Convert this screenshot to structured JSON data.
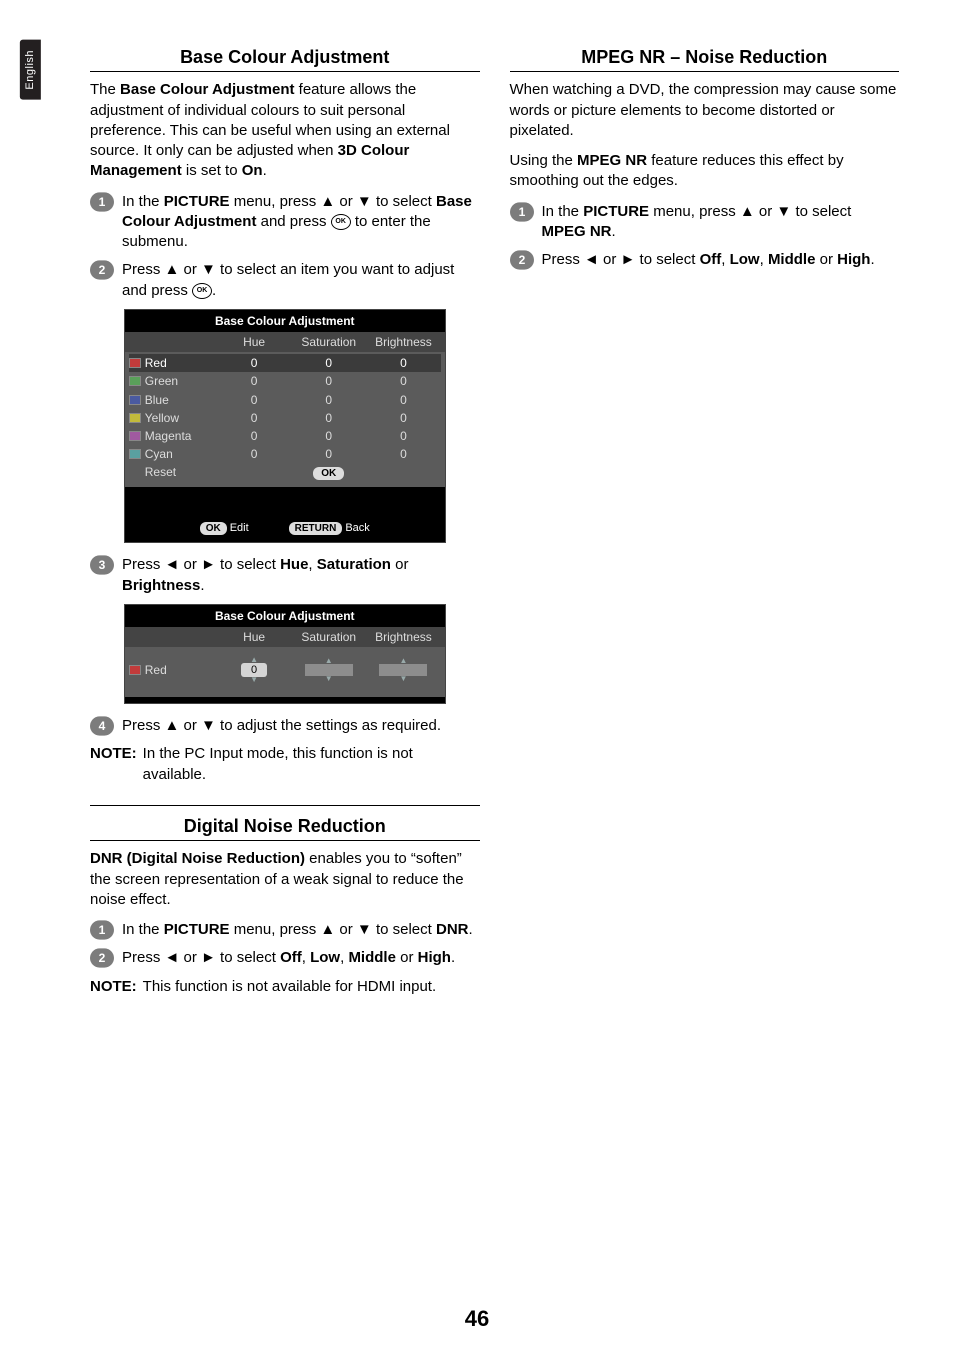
{
  "language_tab": "English",
  "page_number": "46",
  "icons": {
    "ok_small": "OK"
  },
  "left": {
    "sec1": {
      "title": "Base Colour Adjustment",
      "intro_parts": [
        "The ",
        "Base Colour Adjustment",
        " feature allows the adjustment of individual colours to suit personal preference. This can be useful when using an external source. It only can be adjusted when ",
        "3D Colour Management",
        " is set to ",
        "On",
        "."
      ],
      "step1_parts": [
        "In the ",
        "PICTURE",
        " menu, press ▲ or ▼ to select ",
        "Base Colour Adjustment",
        " and press ",
        " to enter the submenu."
      ],
      "step2_parts": [
        "Press ▲ or ▼ to select an item you want to adjust and press ",
        "."
      ],
      "step3_parts": [
        "Press ◄ or ► to select ",
        "Hue",
        ", ",
        "Saturation",
        " or ",
        "Brightness",
        "."
      ],
      "step4": "Press ▲ or ▼ to adjust the settings as required.",
      "note_label": "NOTE:",
      "note_text": "In the PC Input mode, this function is not available.",
      "osd1": {
        "title": "Base Colour Adjustment",
        "headers": [
          "Hue",
          "Saturation",
          "Brightness"
        ],
        "rows": [
          {
            "swatch": "#c23b3b",
            "label": "Red",
            "vals": [
              "0",
              "0",
              "0"
            ],
            "selected": true
          },
          {
            "swatch": "#5aa05a",
            "label": "Green",
            "vals": [
              "0",
              "0",
              "0"
            ]
          },
          {
            "swatch": "#4a5aa0",
            "label": "Blue",
            "vals": [
              "0",
              "0",
              "0"
            ]
          },
          {
            "swatch": "#c2bb3b",
            "label": "Yellow",
            "vals": [
              "0",
              "0",
              "0"
            ]
          },
          {
            "swatch": "#a05aa0",
            "label": "Magenta",
            "vals": [
              "0",
              "0",
              "0"
            ]
          },
          {
            "swatch": "#5aa0a0",
            "label": "Cyan",
            "vals": [
              "0",
              "0",
              "0"
            ]
          }
        ],
        "reset_label": "Reset",
        "reset_ok": "OK",
        "foot_ok": "OK",
        "foot_edit": "Edit",
        "foot_return": "RETURN",
        "foot_back": "Back"
      },
      "osd2": {
        "title": "Base Colour Adjustment",
        "headers": [
          "Hue",
          "Saturation",
          "Brightness"
        ],
        "swatch": "#c23b3b",
        "label": "Red",
        "value": "0"
      }
    },
    "sec2": {
      "title": "Digital Noise Reduction",
      "intro_parts": [
        "DNR (Digital Noise Reduction)",
        " enables you to “soften” the screen representation of a weak signal to reduce the noise effect."
      ],
      "step1_parts": [
        "In the ",
        "PICTURE",
        " menu, press ▲ or ▼ to select ",
        "DNR",
        "."
      ],
      "step2_parts": [
        "Press ◄ or ► to select ",
        "Off",
        ", ",
        "Low",
        ", ",
        "Middle",
        " or ",
        "High",
        "."
      ],
      "note_label": "NOTE:",
      "note_text": "This function is not available for HDMI input."
    }
  },
  "right": {
    "sec1": {
      "title": "MPEG NR – Noise Reduction",
      "intro1": "When watching a DVD, the compression may cause some words or picture elements to become distorted or pixelated.",
      "intro2_parts": [
        "Using the ",
        "MPEG NR",
        " feature reduces this effect by smoothing out the edges."
      ],
      "step1_parts": [
        "In the ",
        "PICTURE",
        " menu, press ▲ or ▼ to select ",
        "MPEG NR",
        "."
      ],
      "step2_parts": [
        "Press ◄ or ► to select ",
        "Off",
        ", ",
        "Low",
        ", ",
        "Middle",
        " or ",
        "High",
        "."
      ]
    }
  }
}
